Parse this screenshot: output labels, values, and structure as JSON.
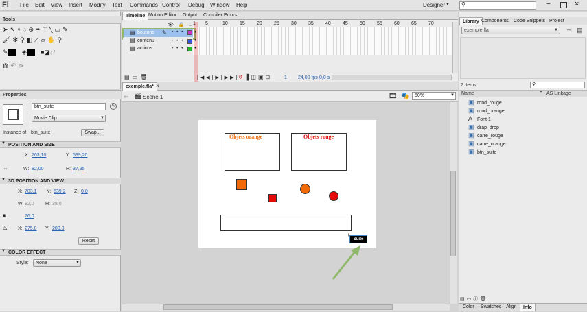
{
  "app": {
    "logo": "Fl",
    "workspace": "Designer"
  },
  "menu": [
    "File",
    "Edit",
    "View",
    "Insert",
    "Modify",
    "Text",
    "Commands",
    "Control",
    "Debug",
    "Window",
    "Help"
  ],
  "tools": {
    "title": "Tools"
  },
  "timeline": {
    "tabs": [
      "Timeline",
      "Motion Editor",
      "Output",
      "Compiler Errors"
    ],
    "ticks": [
      "1",
      "5",
      "10",
      "15",
      "20",
      "25",
      "30",
      "35",
      "40",
      "45",
      "50",
      "55",
      "60",
      "65",
      "70"
    ],
    "layers": [
      {
        "name": "boutons",
        "color": "#cc33cc"
      },
      {
        "name": "contenu",
        "color": "#3355dd"
      },
      {
        "name": "actions",
        "color": "#22bb22"
      }
    ],
    "frame": "1",
    "fps": "24,00 fps",
    "time": "0,0 s"
  },
  "doc": {
    "tab": "exemple.fla*",
    "scene": "Scene 1",
    "zoom": "50%"
  },
  "stage": {
    "box1": "Objets orange",
    "box2": "Objets rouge",
    "button": "Suite"
  },
  "properties": {
    "title": "Properties",
    "instance_name": "btn_suite",
    "type": "Movie Clip",
    "instance_of_label": "Instance of:",
    "instance_of": "btn_suite",
    "swap": "Swap...",
    "pos_section": "POSITION AND SIZE",
    "x_label": "X:",
    "x": "703,10",
    "y_label": "Y:",
    "y": "539,20",
    "w_label": "W:",
    "w": "82,00",
    "h_label": "H:",
    "h": "37,95",
    "pos3d_section": "3D POSITION AND VIEW",
    "x3": "703,1",
    "y3": "539,2",
    "z_label": "Z:",
    "z": "0,0",
    "w3": "82,0",
    "h3": "38,0",
    "persp": "76,0",
    "vx": "275,0",
    "vy": "200,0",
    "reset": "Reset",
    "color_section": "COLOR EFFECT",
    "style_label": "Style:",
    "style": "None"
  },
  "library": {
    "tabs": [
      "Library",
      "Components",
      "Code Snippets",
      "Project"
    ],
    "file": "exemple.fla",
    "count": "7 items",
    "col_name": "Name",
    "col_link": "AS Linkage",
    "items": [
      {
        "name": "rond_rouge",
        "icon": "movieclip-icon"
      },
      {
        "name": "rond_orange",
        "icon": "movieclip-icon"
      },
      {
        "name": "Font 1",
        "icon": "font-icon"
      },
      {
        "name": "drap_drop",
        "icon": "movieclip-icon"
      },
      {
        "name": "carre_rouge",
        "icon": "movieclip-icon"
      },
      {
        "name": "carre_orange",
        "icon": "movieclip-icon"
      },
      {
        "name": "btn_suite",
        "icon": "movieclip-icon"
      }
    ],
    "bottom_tabs": [
      "Color",
      "Swatches",
      "Align",
      "Info"
    ]
  },
  "colors": {
    "accent": "#8fb86a",
    "stage": "#ffffff",
    "playhead": "#e02020"
  }
}
